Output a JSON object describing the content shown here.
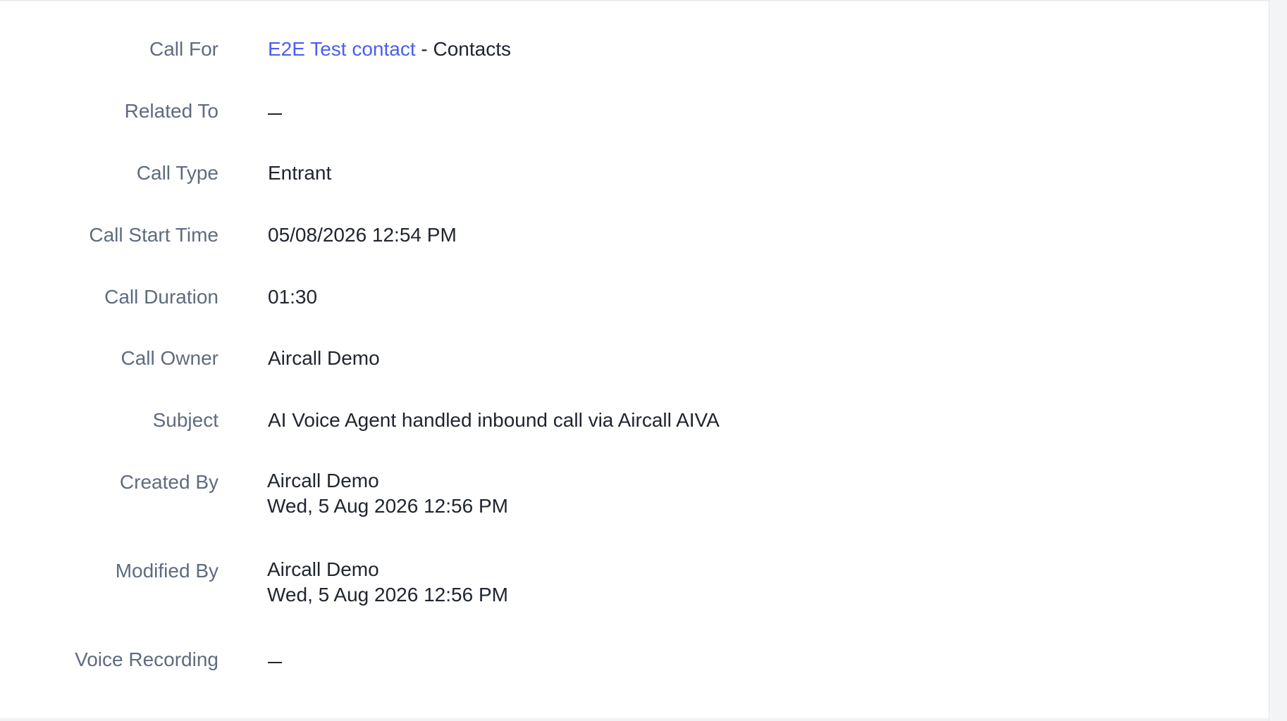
{
  "fields": [
    {
      "label": "Call For",
      "link_text": "E2E Test contact",
      "suffix": " - Contacts"
    },
    {
      "label": "Related To",
      "value": "—"
    },
    {
      "label": "Call Type",
      "value": "Entrant"
    },
    {
      "label": "Call Start Time",
      "value": "05/08/2026 12:54 PM"
    },
    {
      "label": "Call Duration",
      "value": "01:30"
    },
    {
      "label": "Call Owner",
      "value": "Aircall Demo"
    },
    {
      "label": "Subject",
      "value": "AI Voice Agent handled inbound call via Aircall AIVA"
    },
    {
      "label": "Created By",
      "value": "Aircall Demo",
      "value2": "Wed, 5 Aug 2026 12:56 PM"
    },
    {
      "label": "Modified By",
      "value": "Aircall Demo",
      "value2": "Wed, 5 Aug 2026 12:56 PM"
    },
    {
      "label": "Voice Recording",
      "value": "—"
    }
  ],
  "colors": {
    "label": "#5f6b7f",
    "value": "#20252f",
    "link": "#4a5ef0"
  }
}
